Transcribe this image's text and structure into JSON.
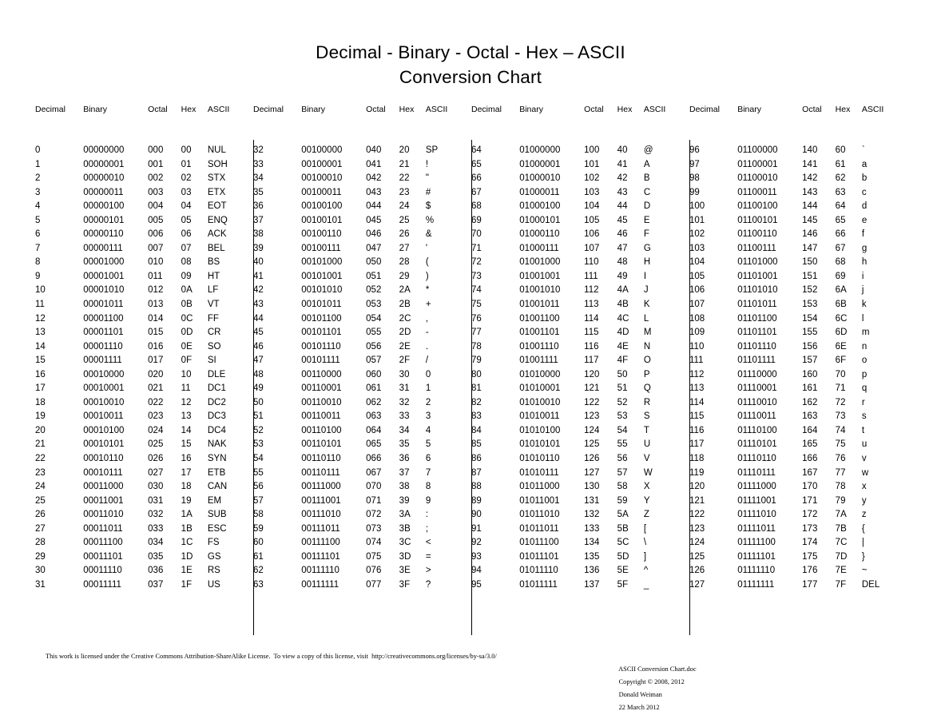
{
  "title": {
    "line1": "Decimal - Binary - Octal - Hex – ASCII",
    "line2": "Conversion Chart"
  },
  "columns": {
    "decimal": "Decimal",
    "binary": "Binary",
    "octal": "Octal",
    "hex": "Hex",
    "ascii": "ASCII"
  },
  "footer": {
    "license": "This work is licensed under the Creative Commons Attribution-ShareAlike License.  To view a copy of this license, visit  http://creativecommons.org/licenses/by-sa/3.0/",
    "filename": "ASCII Conversion Chart.doc",
    "copyright": "Copyright © 2008, 2012",
    "author": "Donald Weiman",
    "date": "22 March 2012"
  },
  "chart_data": {
    "type": "table",
    "title": "Decimal - Binary - Octal - Hex – ASCII Conversion Chart",
    "column_headers": [
      "Decimal",
      "Binary",
      "Octal",
      "Hex",
      "ASCII"
    ],
    "block_count": 4,
    "rows_per_block": 32,
    "decimal_range": [
      0,
      127
    ],
    "blocks": [
      {
        "range": [
          0,
          31
        ],
        "rows": [
          [
            "0",
            "00000000",
            "000",
            "00",
            "NUL"
          ],
          [
            "1",
            "00000001",
            "001",
            "01",
            "SOH"
          ],
          [
            "2",
            "00000010",
            "002",
            "02",
            "STX"
          ],
          [
            "3",
            "00000011",
            "003",
            "03",
            "ETX"
          ],
          [
            "4",
            "00000100",
            "004",
            "04",
            "EOT"
          ],
          [
            "5",
            "00000101",
            "005",
            "05",
            "ENQ"
          ],
          [
            "6",
            "00000110",
            "006",
            "06",
            "ACK"
          ],
          [
            "7",
            "00000111",
            "007",
            "07",
            "BEL"
          ],
          [
            "8",
            "00001000",
            "010",
            "08",
            "BS"
          ],
          [
            "9",
            "00001001",
            "011",
            "09",
            "HT"
          ],
          [
            "10",
            "00001010",
            "012",
            "0A",
            "LF"
          ],
          [
            "11",
            "00001011",
            "013",
            "0B",
            "VT"
          ],
          [
            "12",
            "00001100",
            "014",
            "0C",
            "FF"
          ],
          [
            "13",
            "00001101",
            "015",
            "0D",
            "CR"
          ],
          [
            "14",
            "00001110",
            "016",
            "0E",
            "SO"
          ],
          [
            "15",
            "00001111",
            "017",
            "0F",
            "SI"
          ],
          [
            "16",
            "00010000",
            "020",
            "10",
            "DLE"
          ],
          [
            "17",
            "00010001",
            "021",
            "11",
            "DC1"
          ],
          [
            "18",
            "00010010",
            "022",
            "12",
            "DC2"
          ],
          [
            "19",
            "00010011",
            "023",
            "13",
            "DC3"
          ],
          [
            "20",
            "00010100",
            "024",
            "14",
            "DC4"
          ],
          [
            "21",
            "00010101",
            "025",
            "15",
            "NAK"
          ],
          [
            "22",
            "00010110",
            "026",
            "16",
            "SYN"
          ],
          [
            "23",
            "00010111",
            "027",
            "17",
            "ETB"
          ],
          [
            "24",
            "00011000",
            "030",
            "18",
            "CAN"
          ],
          [
            "25",
            "00011001",
            "031",
            "19",
            "EM"
          ],
          [
            "26",
            "00011010",
            "032",
            "1A",
            "SUB"
          ],
          [
            "27",
            "00011011",
            "033",
            "1B",
            "ESC"
          ],
          [
            "28",
            "00011100",
            "034",
            "1C",
            "FS"
          ],
          [
            "29",
            "00011101",
            "035",
            "1D",
            "GS"
          ],
          [
            "30",
            "00011110",
            "036",
            "1E",
            "RS"
          ],
          [
            "31",
            "00011111",
            "037",
            "1F",
            "US"
          ]
        ]
      },
      {
        "range": [
          32,
          63
        ],
        "rows": [
          [
            "32",
            "00100000",
            "040",
            "20",
            "SP"
          ],
          [
            "33",
            "00100001",
            "041",
            "21",
            "!"
          ],
          [
            "34",
            "00100010",
            "042",
            "22",
            "\""
          ],
          [
            "35",
            "00100011",
            "043",
            "23",
            "#"
          ],
          [
            "36",
            "00100100",
            "044",
            "24",
            "$"
          ],
          [
            "37",
            "00100101",
            "045",
            "25",
            "%"
          ],
          [
            "38",
            "00100110",
            "046",
            "26",
            "&"
          ],
          [
            "39",
            "00100111",
            "047",
            "27",
            "'"
          ],
          [
            "40",
            "00101000",
            "050",
            "28",
            "("
          ],
          [
            "41",
            "00101001",
            "051",
            "29",
            ")"
          ],
          [
            "42",
            "00101010",
            "052",
            "2A",
            "*"
          ],
          [
            "43",
            "00101011",
            "053",
            "2B",
            "+"
          ],
          [
            "44",
            "00101100",
            "054",
            "2C",
            ","
          ],
          [
            "45",
            "00101101",
            "055",
            "2D",
            "-"
          ],
          [
            "46",
            "00101110",
            "056",
            "2E",
            "."
          ],
          [
            "47",
            "00101111",
            "057",
            "2F",
            "/"
          ],
          [
            "48",
            "00110000",
            "060",
            "30",
            "0"
          ],
          [
            "49",
            "00110001",
            "061",
            "31",
            "1"
          ],
          [
            "50",
            "00110010",
            "062",
            "32",
            "2"
          ],
          [
            "51",
            "00110011",
            "063",
            "33",
            "3"
          ],
          [
            "52",
            "00110100",
            "064",
            "34",
            "4"
          ],
          [
            "53",
            "00110101",
            "065",
            "35",
            "5"
          ],
          [
            "54",
            "00110110",
            "066",
            "36",
            "6"
          ],
          [
            "55",
            "00110111",
            "067",
            "37",
            "7"
          ],
          [
            "56",
            "00111000",
            "070",
            "38",
            "8"
          ],
          [
            "57",
            "00111001",
            "071",
            "39",
            "9"
          ],
          [
            "58",
            "00111010",
            "072",
            "3A",
            ":"
          ],
          [
            "59",
            "00111011",
            "073",
            "3B",
            ";"
          ],
          [
            "60",
            "00111100",
            "074",
            "3C",
            "<"
          ],
          [
            "61",
            "00111101",
            "075",
            "3D",
            "="
          ],
          [
            "62",
            "00111110",
            "076",
            "3E",
            ">"
          ],
          [
            "63",
            "00111111",
            "077",
            "3F",
            "?"
          ]
        ]
      },
      {
        "range": [
          64,
          95
        ],
        "rows": [
          [
            "64",
            "01000000",
            "100",
            "40",
            "@"
          ],
          [
            "65",
            "01000001",
            "101",
            "41",
            "A"
          ],
          [
            "66",
            "01000010",
            "102",
            "42",
            "B"
          ],
          [
            "67",
            "01000011",
            "103",
            "43",
            "C"
          ],
          [
            "68",
            "01000100",
            "104",
            "44",
            "D"
          ],
          [
            "69",
            "01000101",
            "105",
            "45",
            "E"
          ],
          [
            "70",
            "01000110",
            "106",
            "46",
            "F"
          ],
          [
            "71",
            "01000111",
            "107",
            "47",
            "G"
          ],
          [
            "72",
            "01001000",
            "110",
            "48",
            "H"
          ],
          [
            "73",
            "01001001",
            "111",
            "49",
            "I"
          ],
          [
            "74",
            "01001010",
            "112",
            "4A",
            "J"
          ],
          [
            "75",
            "01001011",
            "113",
            "4B",
            "K"
          ],
          [
            "76",
            "01001100",
            "114",
            "4C",
            "L"
          ],
          [
            "77",
            "01001101",
            "115",
            "4D",
            "M"
          ],
          [
            "78",
            "01001110",
            "116",
            "4E",
            "N"
          ],
          [
            "79",
            "01001111",
            "117",
            "4F",
            "O"
          ],
          [
            "80",
            "01010000",
            "120",
            "50",
            "P"
          ],
          [
            "81",
            "01010001",
            "121",
            "51",
            "Q"
          ],
          [
            "82",
            "01010010",
            "122",
            "52",
            "R"
          ],
          [
            "83",
            "01010011",
            "123",
            "53",
            "S"
          ],
          [
            "84",
            "01010100",
            "124",
            "54",
            "T"
          ],
          [
            "85",
            "01010101",
            "125",
            "55",
            "U"
          ],
          [
            "86",
            "01010110",
            "126",
            "56",
            "V"
          ],
          [
            "87",
            "01010111",
            "127",
            "57",
            "W"
          ],
          [
            "88",
            "01011000",
            "130",
            "58",
            "X"
          ],
          [
            "89",
            "01011001",
            "131",
            "59",
            "Y"
          ],
          [
            "90",
            "01011010",
            "132",
            "5A",
            "Z"
          ],
          [
            "91",
            "01011011",
            "133",
            "5B",
            "["
          ],
          [
            "92",
            "01011100",
            "134",
            "5C",
            "\\"
          ],
          [
            "93",
            "01011101",
            "135",
            "5D",
            "]"
          ],
          [
            "94",
            "01011110",
            "136",
            "5E",
            "^"
          ],
          [
            "95",
            "01011111",
            "137",
            "5F",
            "_"
          ]
        ]
      },
      {
        "range": [
          96,
          127
        ],
        "rows": [
          [
            "96",
            "01100000",
            "140",
            "60",
            "`"
          ],
          [
            "97",
            "01100001",
            "141",
            "61",
            "a"
          ],
          [
            "98",
            "01100010",
            "142",
            "62",
            "b"
          ],
          [
            "99",
            "01100011",
            "143",
            "63",
            "c"
          ],
          [
            "100",
            "01100100",
            "144",
            "64",
            "d"
          ],
          [
            "101",
            "01100101",
            "145",
            "65",
            "e"
          ],
          [
            "102",
            "01100110",
            "146",
            "66",
            "f"
          ],
          [
            "103",
            "01100111",
            "147",
            "67",
            "g"
          ],
          [
            "104",
            "01101000",
            "150",
            "68",
            "h"
          ],
          [
            "105",
            "01101001",
            "151",
            "69",
            "i"
          ],
          [
            "106",
            "01101010",
            "152",
            "6A",
            "j"
          ],
          [
            "107",
            "01101011",
            "153",
            "6B",
            "k"
          ],
          [
            "108",
            "01101100",
            "154",
            "6C",
            "l"
          ],
          [
            "109",
            "01101101",
            "155",
            "6D",
            "m"
          ],
          [
            "110",
            "01101110",
            "156",
            "6E",
            "n"
          ],
          [
            "111",
            "01101111",
            "157",
            "6F",
            "o"
          ],
          [
            "112",
            "01110000",
            "160",
            "70",
            "p"
          ],
          [
            "113",
            "01110001",
            "161",
            "71",
            "q"
          ],
          [
            "114",
            "01110010",
            "162",
            "72",
            "r"
          ],
          [
            "115",
            "01110011",
            "163",
            "73",
            "s"
          ],
          [
            "116",
            "01110100",
            "164",
            "74",
            "t"
          ],
          [
            "117",
            "01110101",
            "165",
            "75",
            "u"
          ],
          [
            "118",
            "01110110",
            "166",
            "76",
            "v"
          ],
          [
            "119",
            "01110111",
            "167",
            "77",
            "w"
          ],
          [
            "120",
            "01111000",
            "170",
            "78",
            "x"
          ],
          [
            "121",
            "01111001",
            "171",
            "79",
            "y"
          ],
          [
            "122",
            "01111010",
            "172",
            "7A",
            "z"
          ],
          [
            "123",
            "01111011",
            "173",
            "7B",
            "{"
          ],
          [
            "124",
            "01111100",
            "174",
            "7C",
            "|"
          ],
          [
            "125",
            "01111101",
            "175",
            "7D",
            "}"
          ],
          [
            "126",
            "01111110",
            "176",
            "7E",
            "~"
          ],
          [
            "127",
            "01111111",
            "177",
            "7F",
            "DEL"
          ]
        ]
      }
    ]
  }
}
